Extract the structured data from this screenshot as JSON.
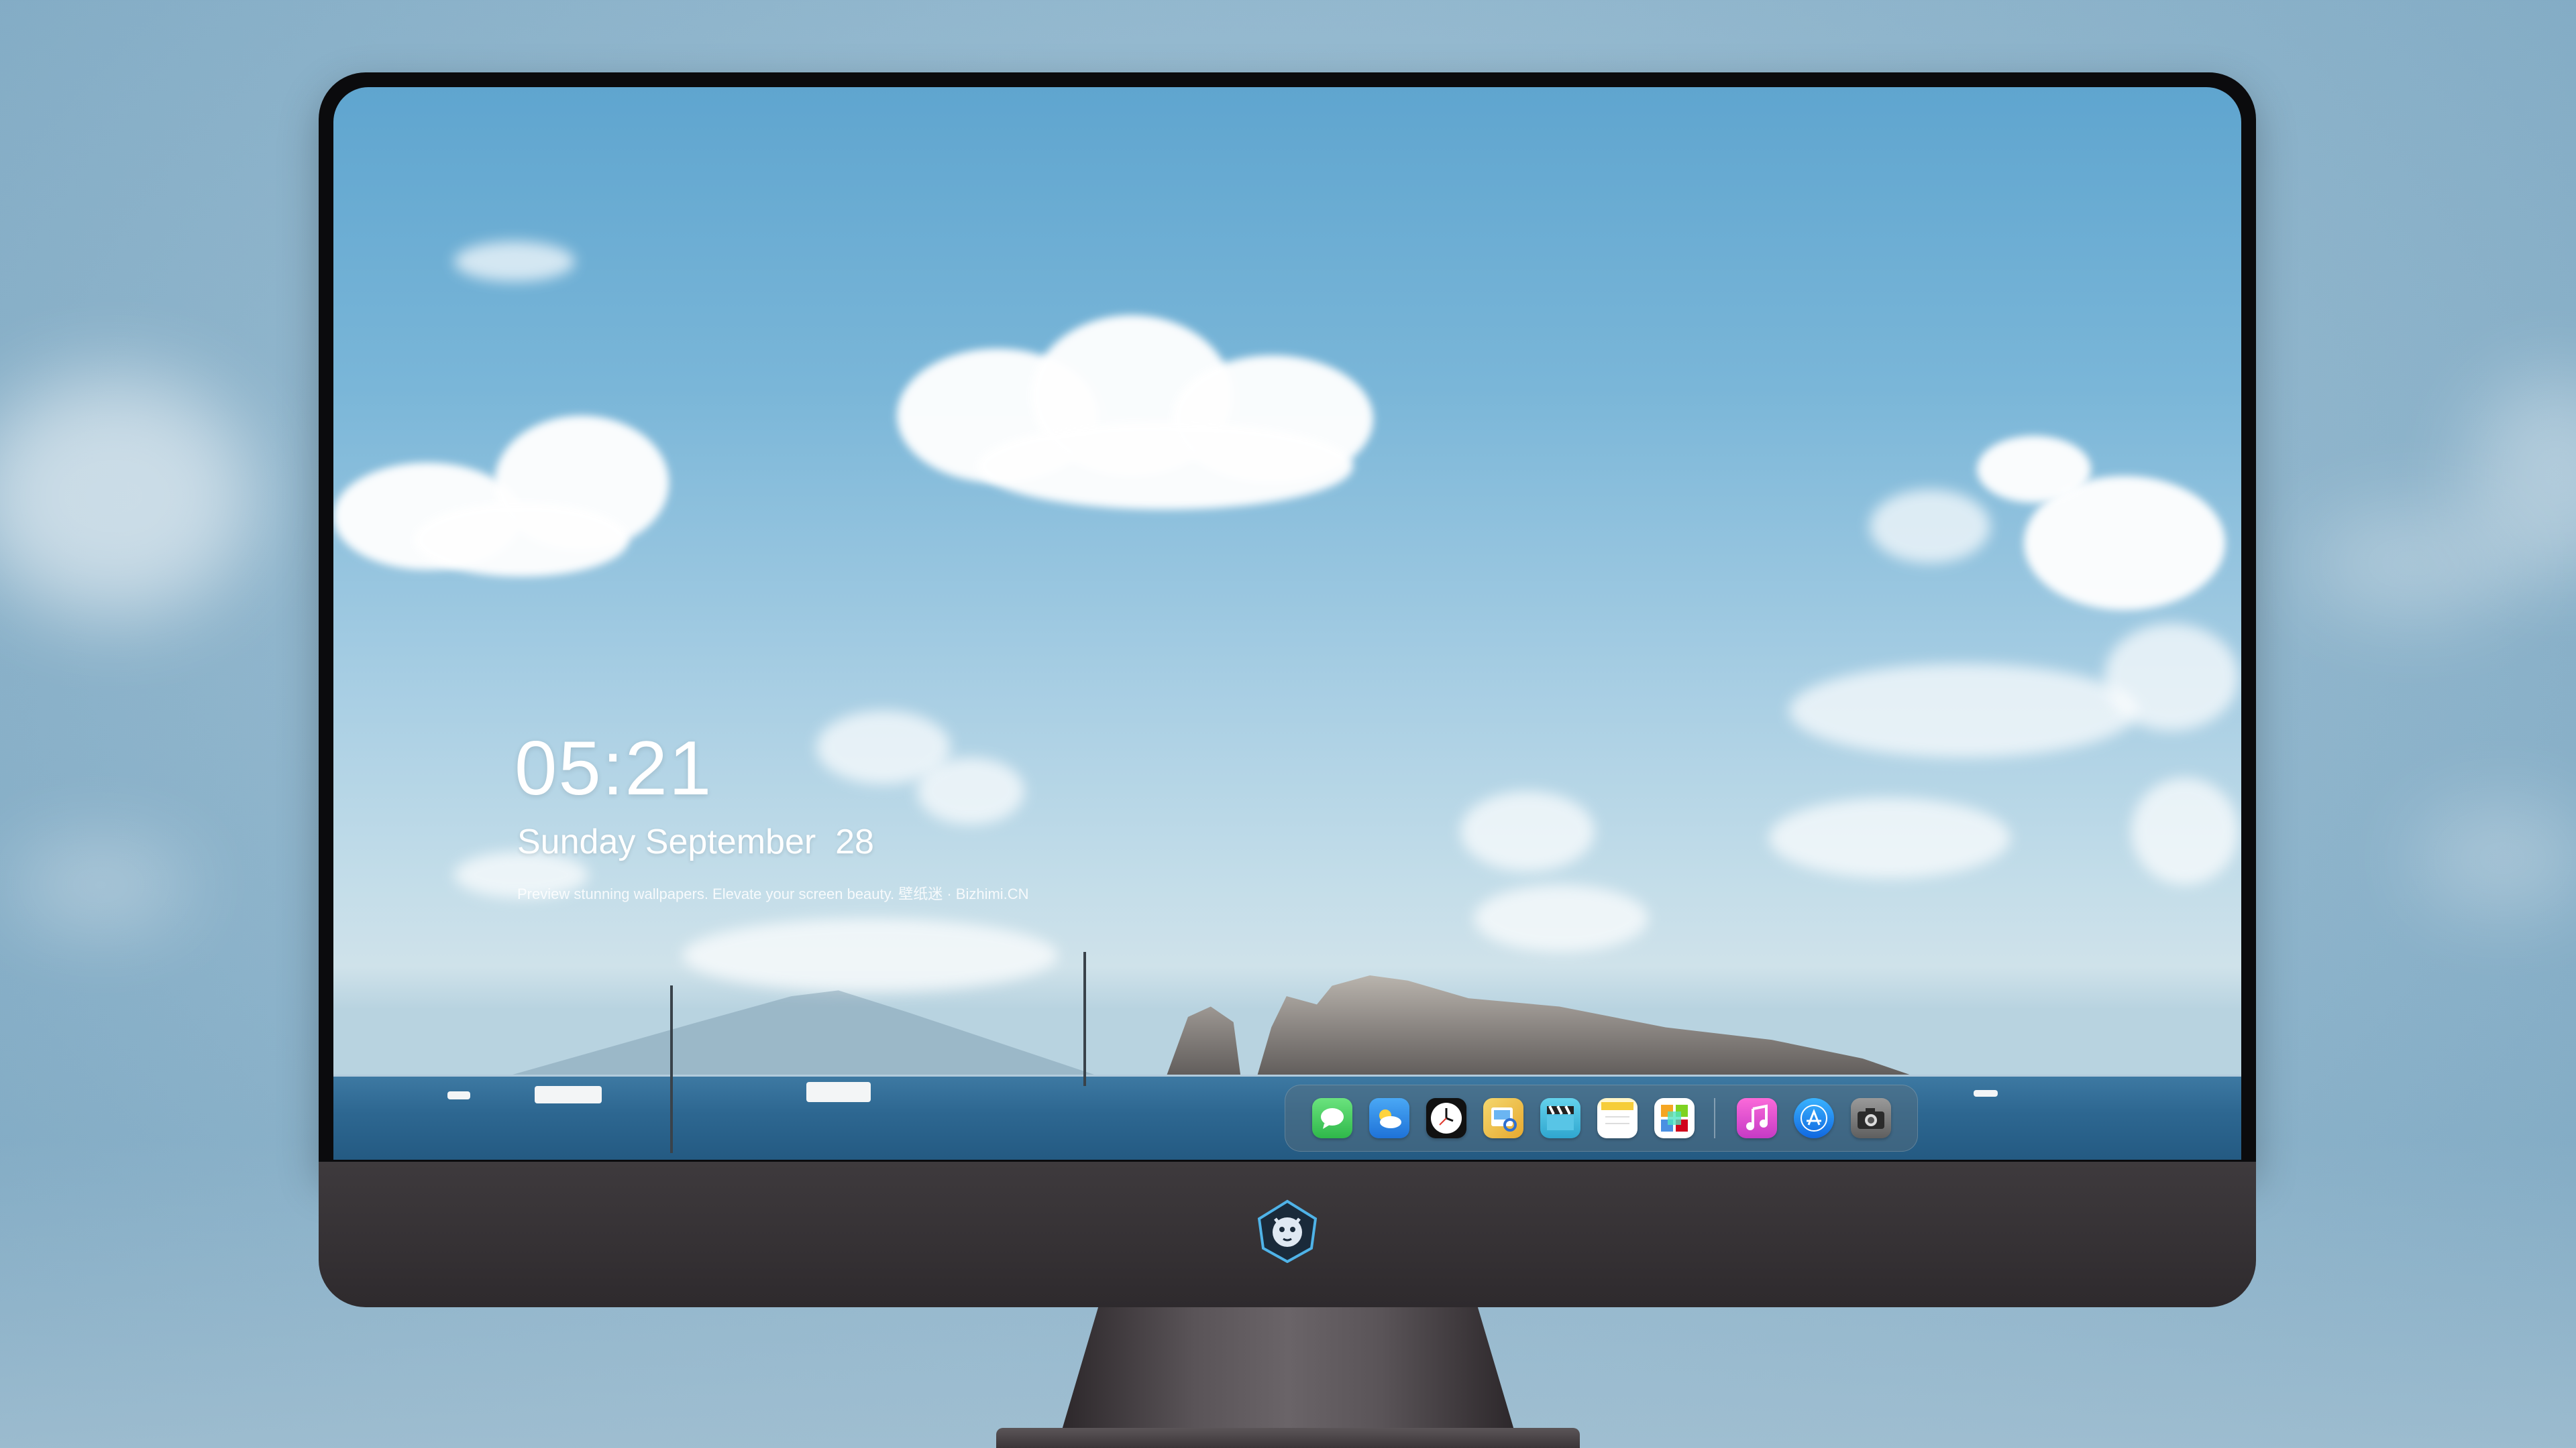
{
  "lock_screen": {
    "time": "05:21",
    "date": "Sunday September  28",
    "tagline": "Preview stunning wallpapers. Elevate your screen beauty. 壁纸迷 · Bizhimi.CN"
  },
  "dock": {
    "apps": [
      {
        "name": "Messages",
        "icon": "messages-icon",
        "color": "#34c759"
      },
      {
        "name": "Weather",
        "icon": "weather-icon",
        "color": "#2e8df0"
      },
      {
        "name": "Clock",
        "icon": "clock-icon",
        "color": "#111111"
      },
      {
        "name": "Preview",
        "icon": "preview-icon",
        "color": "#f2c14e"
      },
      {
        "name": "Clips",
        "icon": "clapperboard-icon",
        "color": "#4cc2e0"
      },
      {
        "name": "Notes",
        "icon": "notes-icon",
        "color": "#f7d34a"
      },
      {
        "name": "Photos",
        "icon": "photos-icon",
        "color": "#ffffff"
      },
      {
        "name": "Music",
        "icon": "music-icon",
        "color": "#e84fd5"
      },
      {
        "name": "App Store",
        "icon": "app-store-icon",
        "color": "#1c8cf5"
      },
      {
        "name": "Camera",
        "icon": "camera-icon",
        "color": "#7d7d7d"
      }
    ]
  },
  "monitor": {
    "logo_icon": "shield-mascot-icon",
    "bezel_color": "#0b0b0d",
    "chin_color": "#3a3639"
  }
}
